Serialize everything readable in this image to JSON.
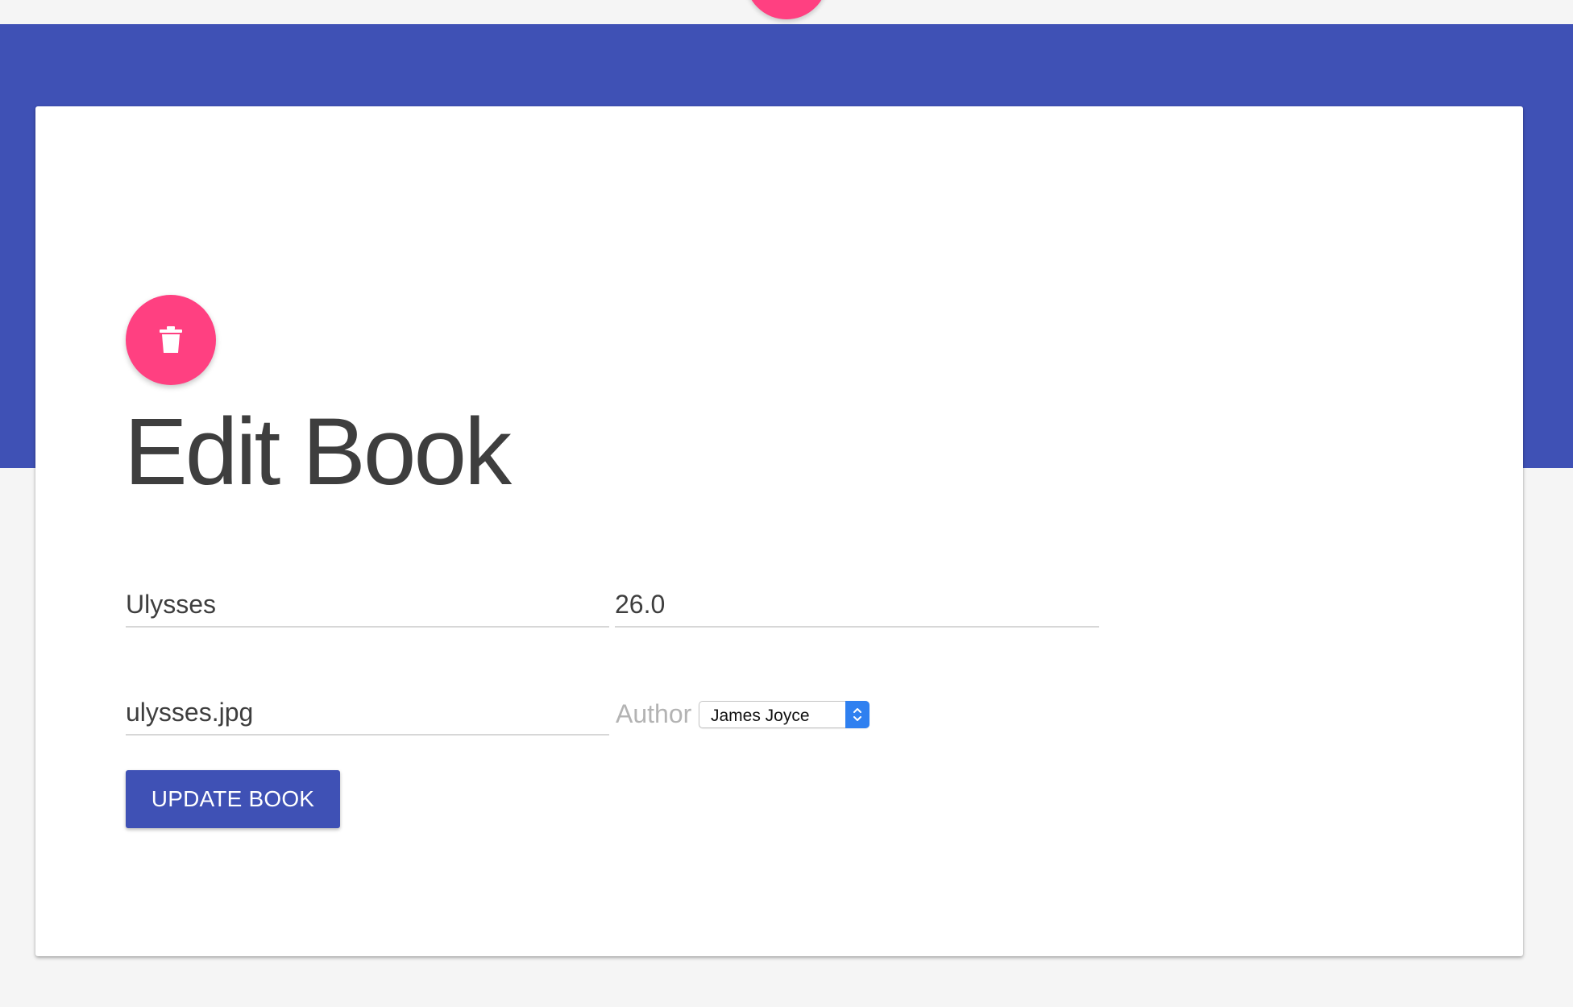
{
  "colors": {
    "background": "#f5f5f5",
    "primary": "#3f51b5",
    "accent": "#ff4081",
    "card": "#ffffff",
    "text": "#3e3e3e",
    "label_muted": "#b3b3b3",
    "select_arrow": "#2f80f0"
  },
  "header": {
    "action_button_icon": "add-icon"
  },
  "form": {
    "delete_button_icon": "trash-icon",
    "title": "Edit Book",
    "book_title_value": "Ulysses",
    "price_value": "26.0",
    "image_value": "ulysses.jpg",
    "author_label": "Author",
    "author_selected": "James Joyce",
    "submit_label": "Update Book"
  }
}
